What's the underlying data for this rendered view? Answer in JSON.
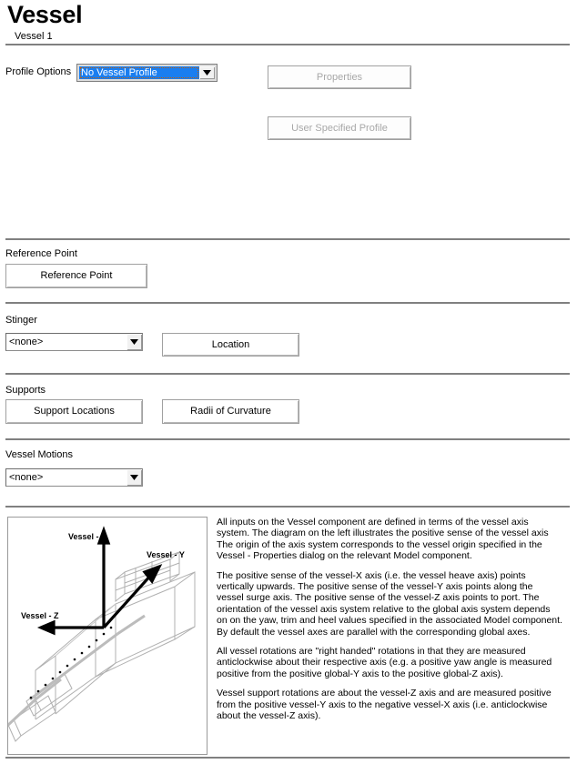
{
  "header": {
    "title": "Vessel",
    "subtitle": "Vessel 1"
  },
  "profile_section": {
    "label": "Profile Options",
    "combo_value": "No Vessel Profile",
    "properties_button": "Properties",
    "user_specified_button": "User Specified Profile"
  },
  "reference_point_section": {
    "label": "Reference Point",
    "button": "Reference Point"
  },
  "stinger_section": {
    "label": "Stinger",
    "combo_value": "<none>",
    "location_button": "Location"
  },
  "supports_section": {
    "label": "Supports",
    "support_locations_button": "Support Locations",
    "radii_button": "Radii of Curvature"
  },
  "vessel_motions_section": {
    "label": "Vessel Motions",
    "combo_value": "<none>"
  },
  "diagram": {
    "axis_x_label": "Vessel - X",
    "axis_y_label": "Vessel - Y",
    "axis_z_label": "Vessel - Z"
  },
  "help": {
    "paragraph_1": "All inputs on the Vessel component are defined in terms of the vessel axis system. The diagram on the left illustrates the positive sense of the vessel axis The origin of the axis system corresponds to the vessel origin specified in the Vessel - Properties dialog on the relevant Model component.",
    "paragraph_2": "The positive sense of the vessel-X axis (i.e. the vessel heave axis) points vertically upwards. The positive sense of the vessel-Y axis points along the vessel surge axis. The positive sense of the vessel-Z axis points to port. The orientation of the vessel axis system relative to the global axis system depends on on the yaw, trim and heel values specified in the associated Model component. By default the vessel axes are parallel with the corresponding global axes.",
    "paragraph_3": "All vessel rotations are \"right handed\" rotations in that they are measured anticlockwise about their respective axis (e.g. a positive yaw angle is measured positive from the positive global-Y axis to the positive global-Z axis).",
    "paragraph_4": "Vessel support rotations are about the vessel-Z axis and are measured positive from the positive vessel-Y axis to the negative vessel-X axis (i.e. anticlockwise about the vessel-Z axis)."
  },
  "colors": {
    "selection_blue": "#1a7ef0",
    "separator_gray": "#808080",
    "disabled_text": "#a8a8a8"
  }
}
